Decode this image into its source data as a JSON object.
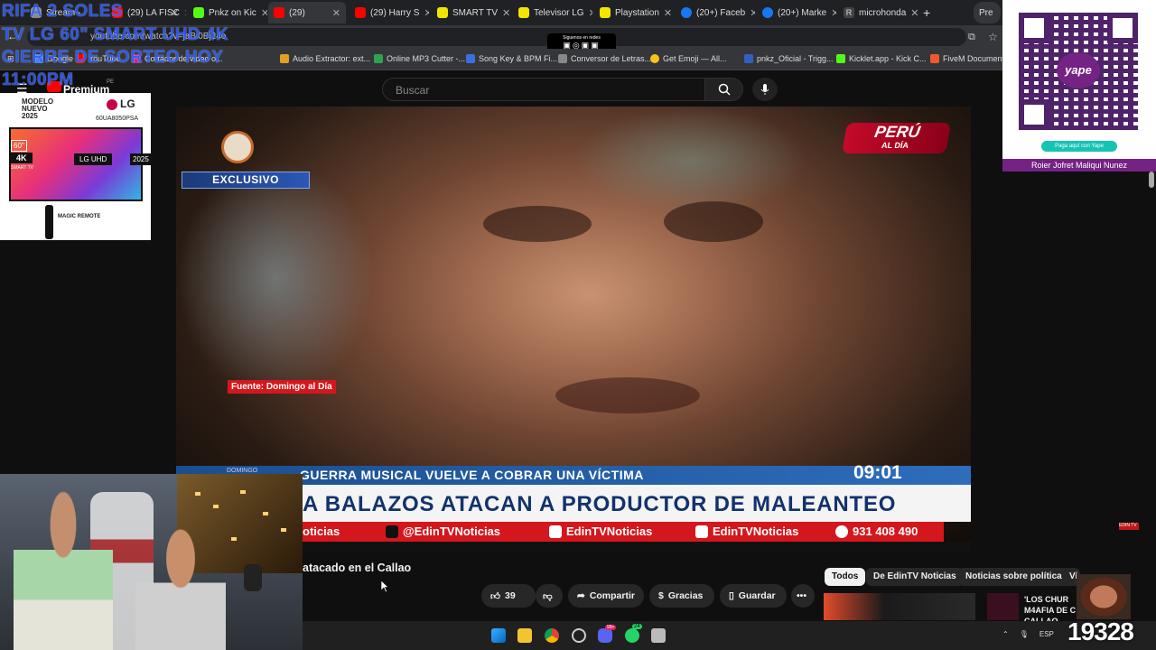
{
  "browser": {
    "tabs": [
      {
        "label": "Stream -",
        "color": "#8a8a8a"
      },
      {
        "label": "(29) LA FISC",
        "color": "#ff0000"
      },
      {
        "label": "Pnkz on Kic",
        "color": "#53fc18"
      },
      {
        "label": "(29)",
        "color": "#ff0000",
        "active": true
      },
      {
        "label": "(29) Harry S",
        "color": "#ff0000"
      },
      {
        "label": "SMART TV",
        "color": "#f2e600"
      },
      {
        "label": "Televisor LG",
        "color": "#f2e600"
      },
      {
        "label": "Playstation",
        "color": "#f2e600"
      },
      {
        "label": "(20+) Faceb",
        "color": "#1877f2"
      },
      {
        "label": "(20+) Marke",
        "color": "#1877f2"
      },
      {
        "label": "microhonda",
        "color": "#dddddd"
      }
    ],
    "url": "youtube.com/watch?v=jaBi0Bj24o",
    "new_tab_icon": "plus-icon",
    "profile_label": "Pre",
    "bookmarks": [
      {
        "label": "Google"
      },
      {
        "label": "YouTube"
      },
      {
        "label": "Cortador de video o..."
      },
      {
        "label": "Audio Extractor: ext..."
      },
      {
        "label": "Online MP3 Cutter -..."
      },
      {
        "label": "Song Key & BPM Fi..."
      },
      {
        "label": "Conversor de Letras..."
      },
      {
        "label": "Get Emoji — All..."
      },
      {
        "label": "pnkz_Oficial - Trigg..."
      },
      {
        "label": "Kicklet.app - Kick C..."
      },
      {
        "label": "FiveM Documentat"
      }
    ]
  },
  "overlay": {
    "line1": "RIFA 2 SOLES",
    "line2": "TV LG 60\" SMART UHD 4K",
    "line3": "CIERRE DE SORTEO HOY",
    "line4": "11:00PM",
    "social_badge": "Siguenos en redes",
    "color": "#2f5fff"
  },
  "youtube": {
    "logo_label": "Premium",
    "region": "PE",
    "search_placeholder": "Buscar",
    "video_title": "atacado en el Callao",
    "likes": "39",
    "actions": {
      "share": "Compartir",
      "thanks": "Gracias",
      "save": "Guardar"
    },
    "chips": [
      "Todos",
      "De EdinTV Noticias",
      "Noticias sobre política",
      "Vi"
    ],
    "related_title": "'LOS CHUR M4AFIA DE C CALLAO"
  },
  "video": {
    "badge_exclusivo": "EXCLUSIVO",
    "channel_logo_main": "PERÚ",
    "channel_logo_sub": "AL DÍA",
    "source": "Fuente: Domingo al Día",
    "ticker_small": "DOMINGO",
    "headline1": "GUERRA MUSICAL VUELVE A COBRAR UNA VÍCTIMA",
    "time": "09:01",
    "headline2": "A BALAZOS ATACAN A PRODUCTOR DE MALEANTEO",
    "social1": "oticias",
    "social2": "@EdinTVNoticias",
    "social3": "EdinTVNoticias",
    "social4": "EdinTVNoticias",
    "social5": "931 408 490",
    "corner_tag": "EDIN TV"
  },
  "yape": {
    "badge": "yape",
    "button": "Paga aquí con Yape",
    "name": "Roier Jofret Maliqui Nunez"
  },
  "lg_ad": {
    "modelo": "MODELO",
    "nuevo": "NUEVO",
    "year": "2025",
    "brand": "LG",
    "model": "60UA8050PSA",
    "size": "60\"",
    "res": "4K",
    "smart": "SMART TV",
    "uhd": "LG UHD",
    "tv_year": "2025",
    "remote": "MAGIC REMOTE"
  },
  "taskbar": {
    "lang": "ESP",
    "counter": "19328",
    "badge1": "99+",
    "badge2": "24"
  }
}
